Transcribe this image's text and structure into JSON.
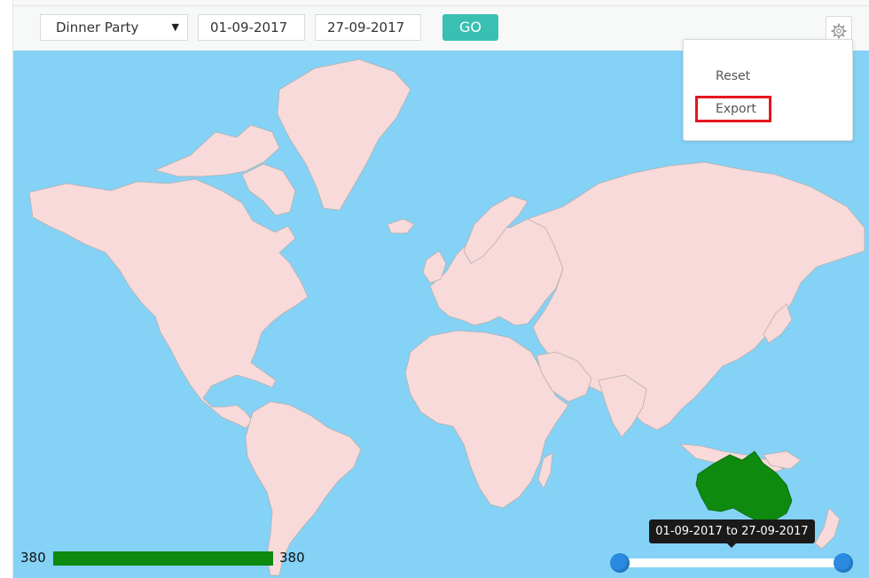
{
  "toolbar": {
    "event_select_value": "Dinner Party",
    "start_date": "01-09-2017",
    "end_date": "27-09-2017",
    "go_label": "GO",
    "settings_icon": "gear-icon"
  },
  "settings_menu": {
    "items": [
      "Reset",
      "Export"
    ]
  },
  "map": {
    "ocean_color": "#84d2f6",
    "land_color": "#f8dada",
    "border_color": "#b9b0b0",
    "highlighted_country": "Australia",
    "highlight_color": "#0e8a0e"
  },
  "legend": {
    "min_value": "380",
    "max_value": "380",
    "bar_color": "#0e8a0e"
  },
  "date_range_slider": {
    "tooltip": "01-09-2017 to 27-09-2017",
    "handle_color": "#2a8be0"
  }
}
